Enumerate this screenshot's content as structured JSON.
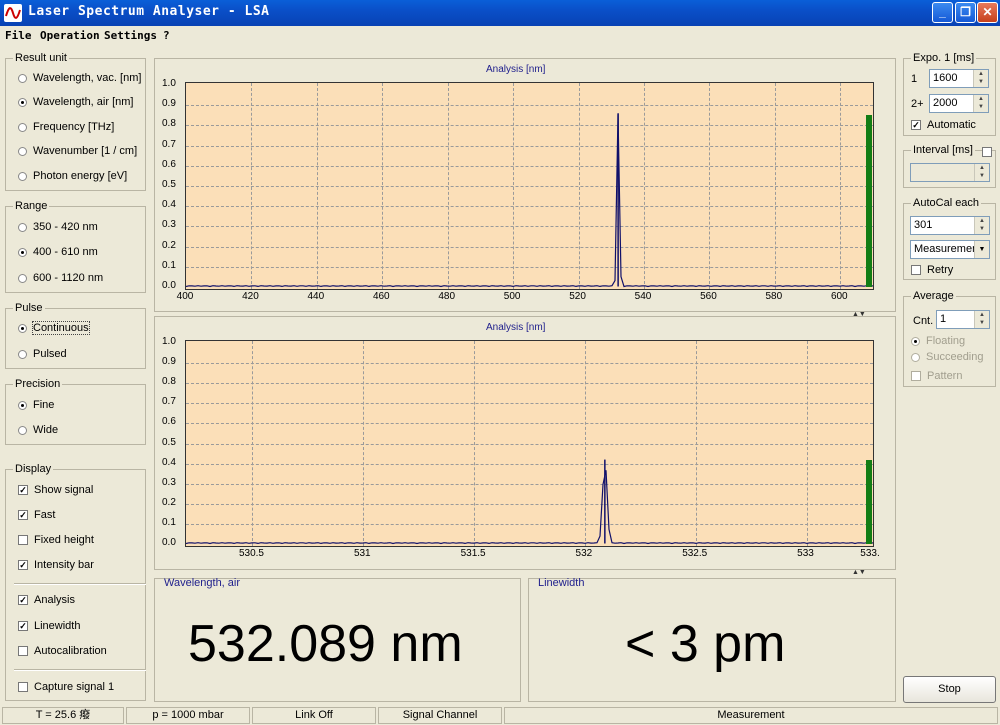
{
  "window": {
    "title": "Laser Spectrum Analyser - LSA"
  },
  "menu": [
    "File",
    "Operation",
    "Settings",
    "?"
  ],
  "result_unit": {
    "title": "Result unit",
    "options": [
      "Wavelength, vac.  [nm]",
      "Wavelength, air  [nm]",
      "Frequency  [THz]",
      "Wavenumber  [1 / cm]",
      "Photon energy  [eV]"
    ],
    "selected": 1
  },
  "range": {
    "title": "Range",
    "options": [
      "350 -   420 nm",
      "400 -   610 nm",
      "600 - 1120 nm"
    ],
    "selected": 1
  },
  "pulse": {
    "title": "Pulse",
    "options": [
      "Continuous",
      "Pulsed"
    ],
    "selected": 0
  },
  "precision": {
    "title": "Precision",
    "options": [
      "Fine",
      "Wide"
    ],
    "selected": 0
  },
  "display": {
    "title": "Display",
    "items": [
      {
        "label": "Show signal",
        "checked": true
      },
      {
        "label": "Fast",
        "checked": true
      },
      {
        "label": "Fixed height",
        "checked": false
      },
      {
        "label": "Intensity bar",
        "checked": true
      },
      {
        "label": "Analysis",
        "checked": true
      },
      {
        "label": "Linewidth",
        "checked": true
      },
      {
        "label": "Autocalibration",
        "checked": false
      },
      {
        "label": "Capture signal 1",
        "checked": false
      }
    ]
  },
  "plot1": {
    "title": "Analysis  [nm]",
    "xticks": [
      "400",
      "420",
      "440",
      "460",
      "480",
      "500",
      "520",
      "540",
      "560",
      "580",
      "600"
    ],
    "yticks": [
      "0.0",
      "0.1",
      "0.2",
      "0.3",
      "0.4",
      "0.5",
      "0.6",
      "0.7",
      "0.8",
      "0.9",
      "1.0"
    ],
    "xmin": 400,
    "xmax": 610,
    "peak_x": 532.09,
    "peak_y": 0.86,
    "intensity": 0.85
  },
  "plot2": {
    "title": "Analysis  [nm]",
    "xticks": [
      "530.5",
      "531",
      "531.5",
      "532",
      "532.5",
      "533",
      "533."
    ],
    "yticks": [
      "0.0",
      "0.1",
      "0.2",
      "0.3",
      "0.4",
      "0.5",
      "0.6",
      "0.7",
      "0.8",
      "0.9",
      "1.0"
    ],
    "xmin": 530.2,
    "xmax": 533.3,
    "peak_x": 532.09,
    "peak_y": 0.42,
    "intensity": 0.42
  },
  "readout_wavelength": {
    "label": "Wavelength,  air",
    "value": "532.089 nm"
  },
  "readout_linewidth": {
    "label": "Linewidth",
    "value": "< 3 pm"
  },
  "expo": {
    "title": "Expo. 1  [ms]",
    "label1": "1",
    "value1": "1600",
    "label2": "2+",
    "value2": "2000",
    "automatic_label": "Automatic",
    "automatic": true
  },
  "interval": {
    "title": "Interval [ms]",
    "value": ""
  },
  "autocal": {
    "title": "AutoCal each",
    "value": "301",
    "mode": "Measuremen",
    "retry_label": "Retry"
  },
  "average": {
    "title": "Average",
    "cnt_label": "Cnt.",
    "cnt_value": "1",
    "floating": "Floating",
    "succeeding": "Succeeding",
    "pattern": "Pattern"
  },
  "stop_label": "Stop",
  "status": [
    "T = 25.6 癈",
    "p = 1000 mbar",
    "Link Off",
    "Signal Channel",
    "Measurement"
  ],
  "colors": {
    "plot_bg": "#fbdfb8",
    "intensity_bar": "#137d14",
    "signal": "#10106a",
    "titlebar": "#0a4fc8"
  }
}
